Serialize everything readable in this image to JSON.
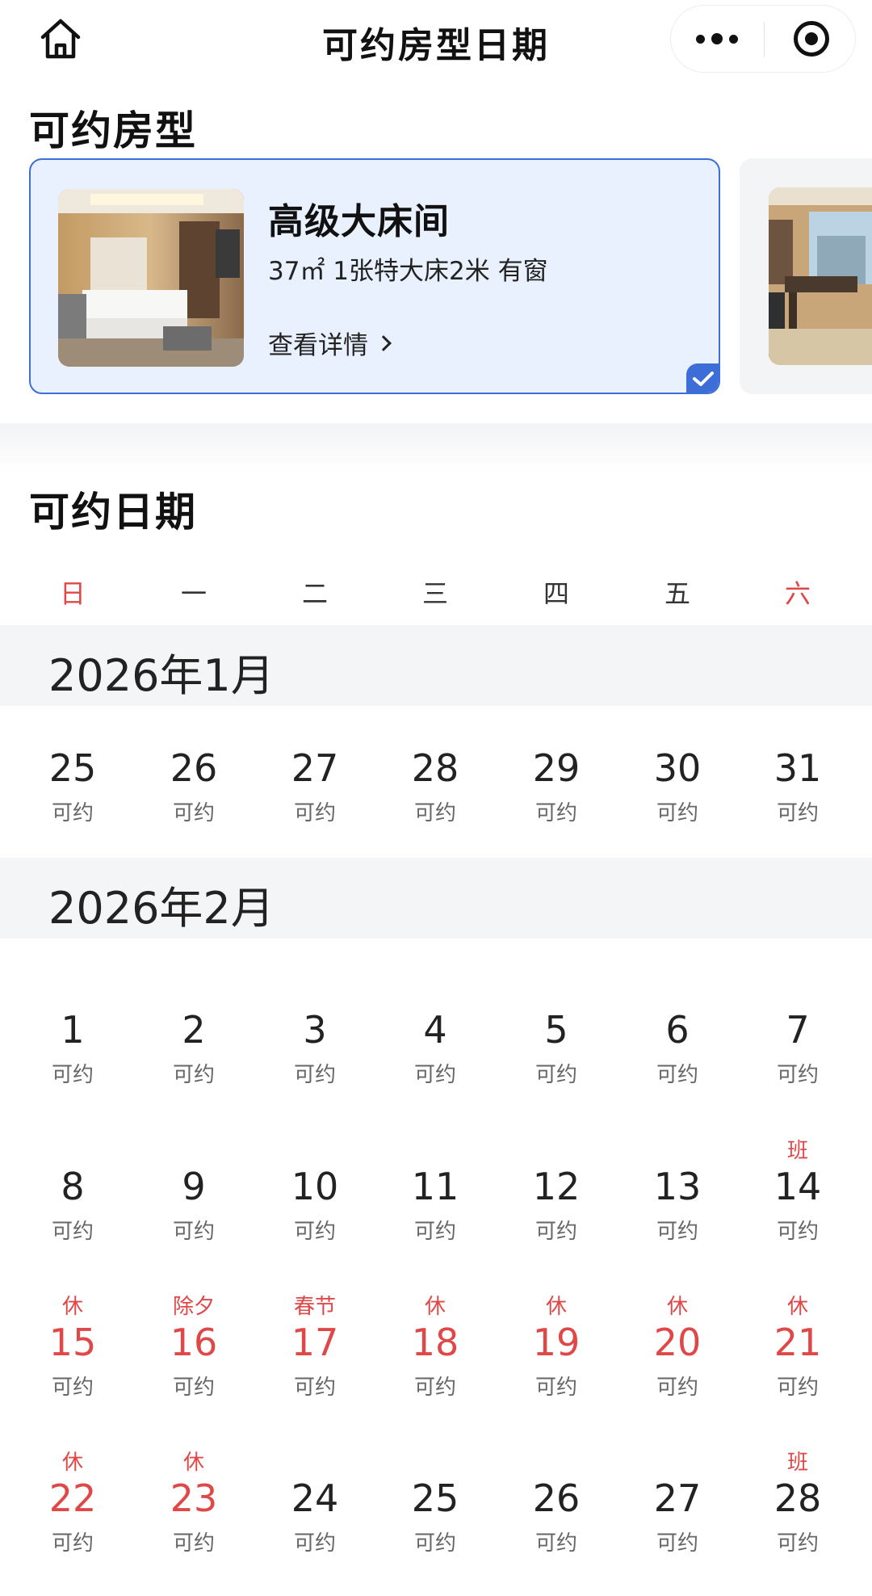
{
  "nav": {
    "title": "可约房型日期",
    "home_icon": "home-icon",
    "more_icon": "more-dots-icon",
    "close_icon": "target-circle-icon"
  },
  "rooms_section": {
    "title": "可约房型",
    "rooms": [
      {
        "name": "高级大床间",
        "specs": "37㎡ 1张特大床2米 有窗",
        "detail_link": "查看详情",
        "selected": true
      },
      {
        "name": "",
        "selected": false
      }
    ]
  },
  "calendar": {
    "title": "可约日期",
    "weekdays": [
      "日",
      "一",
      "二",
      "三",
      "四",
      "五",
      "六"
    ],
    "accent_color": "#e04848",
    "selected_color": "#3d6ed8",
    "months": [
      {
        "label": "2026年1月",
        "days": [
          {
            "day": "25",
            "status": "可约",
            "tag": "",
            "holiday": false
          },
          {
            "day": "26",
            "status": "可约",
            "tag": "",
            "holiday": false
          },
          {
            "day": "27",
            "status": "可约",
            "tag": "",
            "holiday": false
          },
          {
            "day": "28",
            "status": "可约",
            "tag": "",
            "holiday": false
          },
          {
            "day": "29",
            "status": "可约",
            "tag": "",
            "holiday": false
          },
          {
            "day": "30",
            "status": "可约",
            "tag": "",
            "holiday": false
          },
          {
            "day": "31",
            "status": "可约",
            "tag": "",
            "holiday": false
          }
        ]
      },
      {
        "label": "2026年2月",
        "days": [
          {
            "day": "1",
            "status": "可约",
            "tag": "",
            "holiday": false
          },
          {
            "day": "2",
            "status": "可约",
            "tag": "",
            "holiday": false
          },
          {
            "day": "3",
            "status": "可约",
            "tag": "",
            "holiday": false
          },
          {
            "day": "4",
            "status": "可约",
            "tag": "",
            "holiday": false
          },
          {
            "day": "5",
            "status": "可约",
            "tag": "",
            "holiday": false
          },
          {
            "day": "6",
            "status": "可约",
            "tag": "",
            "holiday": false
          },
          {
            "day": "7",
            "status": "可约",
            "tag": "",
            "holiday": false
          },
          {
            "day": "8",
            "status": "可约",
            "tag": "",
            "holiday": false
          },
          {
            "day": "9",
            "status": "可约",
            "tag": "",
            "holiday": false
          },
          {
            "day": "10",
            "status": "可约",
            "tag": "",
            "holiday": false
          },
          {
            "day": "11",
            "status": "可约",
            "tag": "",
            "holiday": false
          },
          {
            "day": "12",
            "status": "可约",
            "tag": "",
            "holiday": false
          },
          {
            "day": "13",
            "status": "可约",
            "tag": "",
            "holiday": false
          },
          {
            "day": "14",
            "status": "可约",
            "tag": "班",
            "holiday": false
          },
          {
            "day": "15",
            "status": "可约",
            "tag": "休",
            "holiday": true
          },
          {
            "day": "16",
            "status": "可约",
            "tag": "除夕",
            "holiday": true
          },
          {
            "day": "17",
            "status": "可约",
            "tag": "春节",
            "holiday": true
          },
          {
            "day": "18",
            "status": "可约",
            "tag": "休",
            "holiday": true
          },
          {
            "day": "19",
            "status": "可约",
            "tag": "休",
            "holiday": true
          },
          {
            "day": "20",
            "status": "可约",
            "tag": "休",
            "holiday": true
          },
          {
            "day": "21",
            "status": "可约",
            "tag": "休",
            "holiday": true
          },
          {
            "day": "22",
            "status": "可约",
            "tag": "休",
            "holiday": true
          },
          {
            "day": "23",
            "status": "可约",
            "tag": "休",
            "holiday": true
          },
          {
            "day": "24",
            "status": "可约",
            "tag": "",
            "holiday": false
          },
          {
            "day": "25",
            "status": "可约",
            "tag": "",
            "holiday": false
          },
          {
            "day": "26",
            "status": "可约",
            "tag": "",
            "holiday": false
          },
          {
            "day": "27",
            "status": "可约",
            "tag": "",
            "holiday": false
          },
          {
            "day": "28",
            "status": "可约",
            "tag": "班",
            "holiday": false
          }
        ]
      }
    ]
  }
}
